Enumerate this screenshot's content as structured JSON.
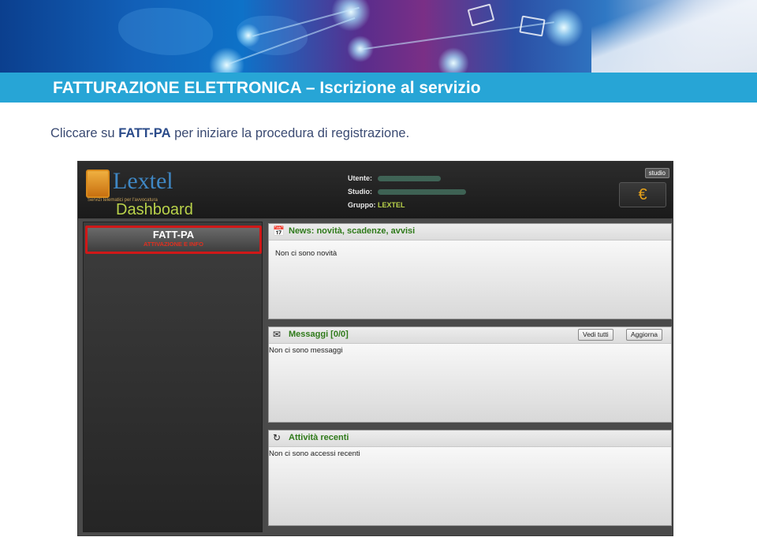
{
  "slide": {
    "title": "FATTURAZIONE ELETTRONICA – Iscrizione al servizio",
    "instruction_pre": "Cliccare su ",
    "instruction_bold": "FATT-PA",
    "instruction_post": " per iniziare la procedura di registrazione."
  },
  "app": {
    "logo_name": "Lextel",
    "logo_tagline": "Servizi telematici per l'avvocatura",
    "logo_sub": "Dashboard",
    "user": {
      "utente_label": "Utente:",
      "studio_label": "Studio:",
      "gruppo_label": "Gruppo:",
      "gruppo_value": "LEXTEL"
    },
    "studio_button": "studio",
    "euro_icon": "€",
    "sidebar": {
      "fatt_title": "FATT-PA",
      "fatt_sub": "ATTIVAZIONE E INFO"
    },
    "news": {
      "icon": "calendar-icon",
      "title": "News: novità, scadenze, avvisi",
      "body": "Non ci sono novità"
    },
    "messages": {
      "icon": "envelope-icon",
      "title": "Messaggi [0/0]",
      "body": "Non ci sono messaggi",
      "btn_view": "Vedi tutti",
      "btn_refresh": "Aggiorna"
    },
    "activity": {
      "icon": "refresh-icon",
      "title": "Attività recenti",
      "body": "Non ci sono accessi recenti"
    }
  },
  "colors": {
    "title_bar": "#27a5d6",
    "highlight": "#d01818",
    "panel_title": "#2f7a1a",
    "accent_green": "#b9d24a"
  }
}
